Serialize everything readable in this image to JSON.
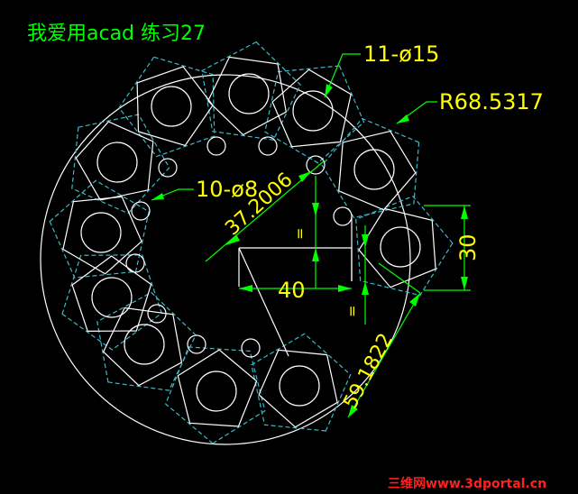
{
  "title": "我爱用acad 练习27",
  "dimensions": {
    "small_holes": "11-ø15",
    "tiny_holes": "10-ø8",
    "outer_radius": "R68.5317",
    "slant_dim": "37.2006",
    "horizontal_dim": "40",
    "vertical_dim": "30",
    "bottom_dim": "59.1822",
    "small_gap_top": "=",
    "small_gap_bottom": "="
  },
  "watermark": "三维网www.3dportal.cn",
  "colors": {
    "background": "#000000",
    "geometry": "#ffffff",
    "hidden_lines": "#3fb8c8",
    "dimensions": "#00ff00",
    "dim_text": "#ffff00",
    "watermark": "#ff2020"
  }
}
